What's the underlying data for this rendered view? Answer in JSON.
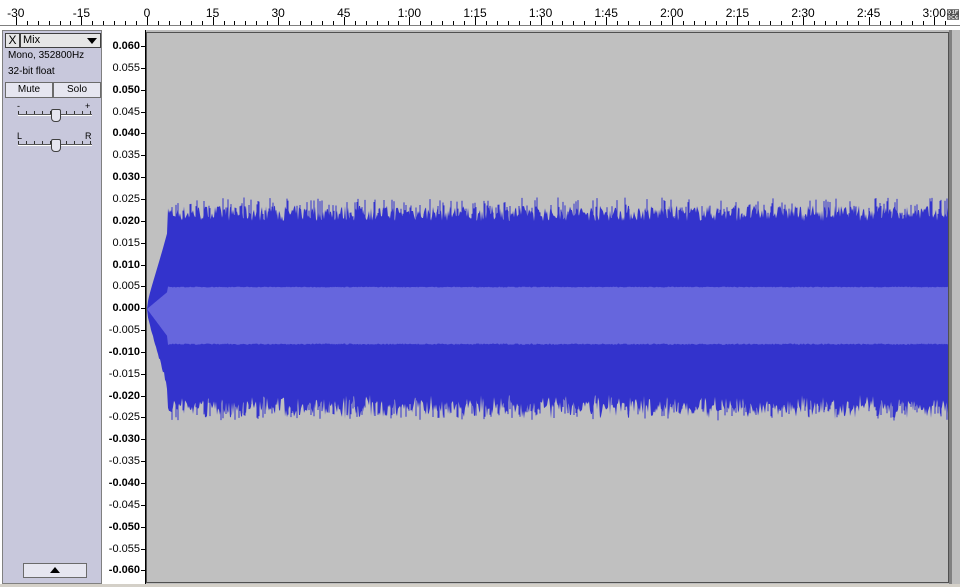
{
  "time_ruler": {
    "labels": [
      {
        "text": "-30",
        "t": -30
      },
      {
        "text": "-15",
        "t": -15
      },
      {
        "text": "0",
        "t": 0
      },
      {
        "text": "15",
        "t": 15
      },
      {
        "text": "30",
        "t": 30
      },
      {
        "text": "45",
        "t": 45
      },
      {
        "text": "1:00",
        "t": 60
      },
      {
        "text": "1:15",
        "t": 75
      },
      {
        "text": "1:30",
        "t": 90
      },
      {
        "text": "1:45",
        "t": 105
      },
      {
        "text": "2:00",
        "t": 120
      },
      {
        "text": "2:15",
        "t": 135
      },
      {
        "text": "2:30",
        "t": 150
      },
      {
        "text": "2:45",
        "t": 165
      },
      {
        "text": "3:00",
        "t": 180
      }
    ]
  },
  "track": {
    "close_symbol": "X",
    "name": "Mix",
    "info_line1": "Mono, 352800Hz",
    "info_line2": "32-bit float",
    "mute_label": "Mute",
    "solo_label": "Solo",
    "gain_minus": "-",
    "gain_plus": "+",
    "pan_left": "L",
    "pan_right": "R",
    "gain_level": 0.5,
    "pan_level": 0.5
  },
  "amplitude_ruler": {
    "labels": [
      "0.060",
      "0.055",
      "0.050",
      "0.045",
      "0.040",
      "0.035",
      "0.030",
      "0.025",
      "0.020",
      "0.015",
      "0.010",
      "0.005",
      "0.000",
      "-0.005",
      "-0.010",
      "-0.015",
      "-0.020",
      "-0.025",
      "-0.030",
      "-0.035",
      "-0.040",
      "-0.045",
      "-0.050",
      "-0.055",
      "-0.060"
    ],
    "bold": [
      "0.060",
      "0.050",
      "0.040",
      "0.030",
      "0.020",
      "0.010",
      "0.000",
      "-0.010",
      "-0.020",
      "-0.030",
      "-0.040",
      "-0.050",
      "-0.060"
    ]
  },
  "waveform": {
    "peak_color": "#3333cc",
    "rms_color": "#6666dd",
    "background_color": "#c0c0c0",
    "start_time": 0,
    "peak_amplitude": 0.02,
    "rms_amplitude": 0.005,
    "amplitude_range": [
      -0.0625,
      0.0625
    ],
    "time_range": [
      0,
      184
    ]
  },
  "icons": {
    "close": "close-icon",
    "dropdown": "chevron-down-icon",
    "collapse": "chevron-up-icon",
    "ruler_end": "playhead-marker-icon"
  }
}
